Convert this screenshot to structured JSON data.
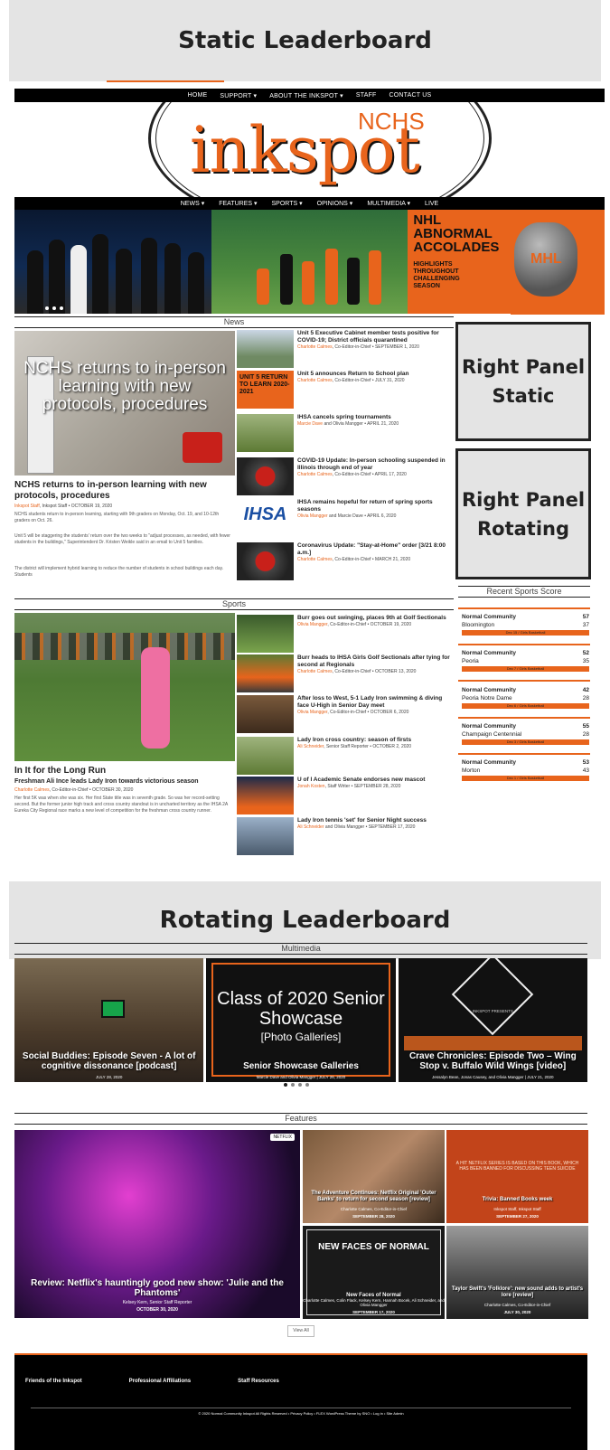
{
  "leaderboards": {
    "static": "Static Leaderboard",
    "rotating": "Rotating Leaderboard"
  },
  "top_nav": [
    "HOME",
    "SUPPORT ▾",
    "ABOUT THE INKSPOT ▾",
    "STAFF",
    "CONTACT US"
  ],
  "masthead": {
    "small": "NCHS",
    "wordmark": "inkspot"
  },
  "main_nav": [
    "NEWS ▾",
    "FEATURES ▾",
    "SPORTS ▾",
    "OPINIONS ▾",
    "MULTIMEDIA ▾",
    "LIVE"
  ],
  "hero": {
    "nhl_title": "NHL ABNORMAL ACCOLADES",
    "nhl_sub": "HIGHLIGHTS THROUGHOUT CHALLENGING SEASON",
    "helmet_text": "MHL",
    "colors": {
      "accent": "#e8641c"
    }
  },
  "news": {
    "section_title": "News",
    "feature": {
      "image_caption": "NCHS returns to in-person learning with new protocols, procedures",
      "headline": "NCHS returns to in-person learning with new protocols, procedures",
      "author": "Inkspot Staff",
      "byline_rest": ", Inkspot Staff • OCTOBER 19, 2020",
      "excerpt1": "NCHS students return to in-person learning, starting with 9th graders on Monday, Oct. 19, and 10-12th graders on Oct. 26.",
      "excerpt2": "Unit 5 will be staggering the students' return over the two weeks to \"adjust processes, as needed, with fewer students in the buildings,\" Superintendent Dr. Kristen Weikle said in an email to Unit 5 families.",
      "excerpt3": "The district will implement hybrid learning to reduce the number of students in school buildings each day. Students"
    },
    "stories": [
      {
        "headline": "Unit 5 Executive Cabinet member tests positive for COVID-19; District officials quarantined",
        "author": "Charlotte Calmes",
        "rest": ", Co-Editor-in-Chief • SEPTEMBER 1, 2020"
      },
      {
        "thumb_text": "UNIT 5 RETURN TO LEARN 2020-2021",
        "headline": "Unit 5 announces Return to School plan",
        "author": "Charlotte Calmes",
        "rest": ", Co-Editor-in-Chief • JULY 31, 2020"
      },
      {
        "headline": "IHSA cancels spring tournaments",
        "author": "Marcie Dave",
        "rest": " and Olivia Mangger • APRIL 21, 2020"
      },
      {
        "headline": "COVID-19 Update: In-person schooling suspended in Illinois through end of year",
        "author": "Charlotte Calmes",
        "rest": ", Co-Editor-in-Chief • APRIL 17, 2020"
      },
      {
        "thumb_text": "IHSA",
        "headline": "IHSA remains hopeful for return of spring sports seasons",
        "author": "Olivia Mangger",
        "rest": " and Marcie Dave • APRIL 6, 2020"
      },
      {
        "headline": "Coronavirus Update: \"Stay-at-Home\" order [3/21 8:00 a.m.]",
        "author": "Charlotte Calmes",
        "rest": ", Co-Editor-in-Chief • MARCH 21, 2020"
      }
    ]
  },
  "right_panel": {
    "static": "Right Panel Static",
    "rotating": "Right Panel Rotating"
  },
  "scores": {
    "title": "Recent Sports Score",
    "games": [
      {
        "team1": "Normal Community",
        "score1": "57",
        "team2": "Bloomington",
        "score2": "37",
        "note": "Dec 15 / Girls Basketball"
      },
      {
        "team1": "Normal Community",
        "score1": "52",
        "team2": "Peoria",
        "score2": "35",
        "note": "Dec 7 / Girls Basketball"
      },
      {
        "team1": "Normal Community",
        "score1": "42",
        "team2": "Peoria Notre Dame",
        "score2": "28",
        "note": "Dec 6 / Girls Basketball"
      },
      {
        "team1": "Normal Community",
        "score1": "55",
        "team2": "Champaign Centennial",
        "score2": "28",
        "note": "Dec 3 / Girls Basketball"
      },
      {
        "team1": "Normal Community",
        "score1": "53",
        "team2": "Morton",
        "score2": "43",
        "note": "Dec 1 / Girls Basketball"
      }
    ]
  },
  "sports": {
    "section_title": "Sports",
    "feature": {
      "headline": "In It for the Long Run",
      "subhead": "Freshman Ali Ince leads Lady Iron towards victorious season",
      "author": "Charlotte Calmes",
      "byline_rest": ", Co-Editor-in-Chief • OCTOBER 30, 2020",
      "excerpt": "Her first 5K was when she was six. Her first State title was in seventh grade. So was her record-setting second. But the former junior high track and cross country standout is in uncharted territory as the IHSA 2A Eureka City Regional race marks a new level of competition for the freshman cross country runner."
    },
    "stories": [
      {
        "headline": "Burr goes out swinging, places 9th at Golf Sectionals",
        "author": "Olivia Mangger",
        "rest": ", Co-Editor-in-Chief • OCTOBER 19, 2020"
      },
      {
        "headline": "Burr heads to IHSA Girls Golf Sectionals after tying for second at Regionals",
        "author": "Charlotte Calmes",
        "rest": ", Co-Editor-in-Chief • OCTOBER 13, 2020"
      },
      {
        "headline": "After loss to West, 5-1 Lady Iron swimming & diving face U-High in Senior Day meet",
        "author": "Olivia Mangger",
        "rest": ", Co-Editor-in-Chief • OCTOBER 6, 2020"
      },
      {
        "headline": "Lady Iron cross country: season of firsts",
        "author": "Ali Schneider",
        "rest": ", Senior Staff Reporter • OCTOBER 2, 2020"
      },
      {
        "headline": "U of I Academic Senate endorses new mascot",
        "author": "Jonah Kosten",
        "rest": ", Staff Writer • SEPTEMBER 28, 2020"
      },
      {
        "headline": "Lady Iron tennis 'set' for Senior Night success",
        "author": "Ali Schneider",
        "rest": " and Olivia Mangger • SEPTEMBER 17, 2020"
      }
    ]
  },
  "multimedia": {
    "section_title": "Multimedia",
    "cards": [
      {
        "caption": "Social Buddies: Episode Seven - A lot of cognitive dissonance [podcast]",
        "sub": "JULY 28, 2020"
      },
      {
        "title1": "Class of 2020 Senior Showcase",
        "title2": "[Photo Galleries]",
        "caption": "Senior Showcase Galleries",
        "sub": "Marcie Dave and Olivia Mangger | JULY 26, 2020"
      },
      {
        "presents": "INKSPOT PRESENTS",
        "caption": "Crave Chronicles: Episode Two – Wing Stop v. Buffalo Wild Wings [video]",
        "sub": "Jessalyn Bean, Jonas Causey, and Olivia Mangger | JULY 21, 2020"
      }
    ]
  },
  "features": {
    "section_title": "Features",
    "main": {
      "badge": "NETFLIX",
      "caption": "Review: Netflix's hauntingly good new show: 'Julie and the Phantoms'",
      "author": "Kelsey Kern, Senior Staff Reporter",
      "date": "OCTOBER 30, 2020"
    },
    "cards": [
      {
        "caption": "The Adventure Continues: Netflix Original 'Outer Banks' to return for second season [review]",
        "author": "Charlotte Calmes, Co-Editor-in-Chief",
        "date": "SEPTEMBER 28, 2020"
      },
      {
        "note": "A HIT NETFLIX SERIES IS BASED ON THIS BOOK, WHICH HAS BEEN BANNED FOR DISCUSSING TEEN SUICIDE",
        "caption": "Trivia: Banned Books week",
        "author": "Inkspot Staff, Inkspot Staff",
        "date": "SEPTEMBER 27, 2020"
      },
      {
        "title": "NEW FACES OF NORMAL",
        "caption": "New Faces of Normal",
        "author": "Charlotte Calmes, Colin Flack, Kelsey Kern, Hannah Bocek, Ali Schneider, and Olivia Mangger",
        "date": "SEPTEMBER 17, 2020"
      },
      {
        "caption": "Taylor Swift's 'Folklore': new sound adds to artist's lore [review]",
        "author": "Charlotte Calmes, Co-Editor-in-Chief",
        "date": "JULY 30, 2020"
      }
    ],
    "view_all": "View All"
  },
  "footer": {
    "links": [
      "Friends of the Inkspot",
      "Professional Affiliations",
      "Staff Resources"
    ],
    "copyright": "© 2020 Normal Community Inkspot All Rights Reserved • Privacy Policy • FLEX WordPress Theme by SNO • Log in • Site Admin"
  }
}
